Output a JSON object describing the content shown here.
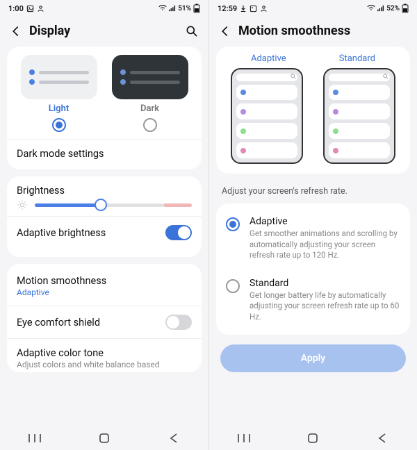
{
  "left": {
    "status": {
      "time": "1:00",
      "battery": "51%"
    },
    "title": "Display",
    "theme": {
      "light_label": "Light",
      "dark_label": "Dark"
    },
    "dark_mode_settings": "Dark mode settings",
    "brightness_label": "Brightness",
    "adaptive_brightness": "Adaptive brightness",
    "motion": {
      "title": "Motion smoothness",
      "value": "Adaptive"
    },
    "eye_comfort": "Eye comfort shield",
    "adaptive_color": {
      "title": "Adaptive color tone",
      "sub": "Adjust colors and white balance based"
    }
  },
  "right": {
    "status": {
      "time": "12:59",
      "battery": "52%"
    },
    "title": "Motion smoothness",
    "preview": {
      "adaptive": "Adaptive",
      "standard": "Standard"
    },
    "info": "Adjust your screen's refresh rate.",
    "options": {
      "adaptive": {
        "title": "Adaptive",
        "desc": "Get smoother animations and scrolling by automatically adjusting your screen refresh rate up to 120 Hz."
      },
      "standard": {
        "title": "Standard",
        "desc": "Get longer battery life by automatically adjusting your screen refresh rate up to 60 Hz."
      }
    },
    "apply": "Apply"
  }
}
